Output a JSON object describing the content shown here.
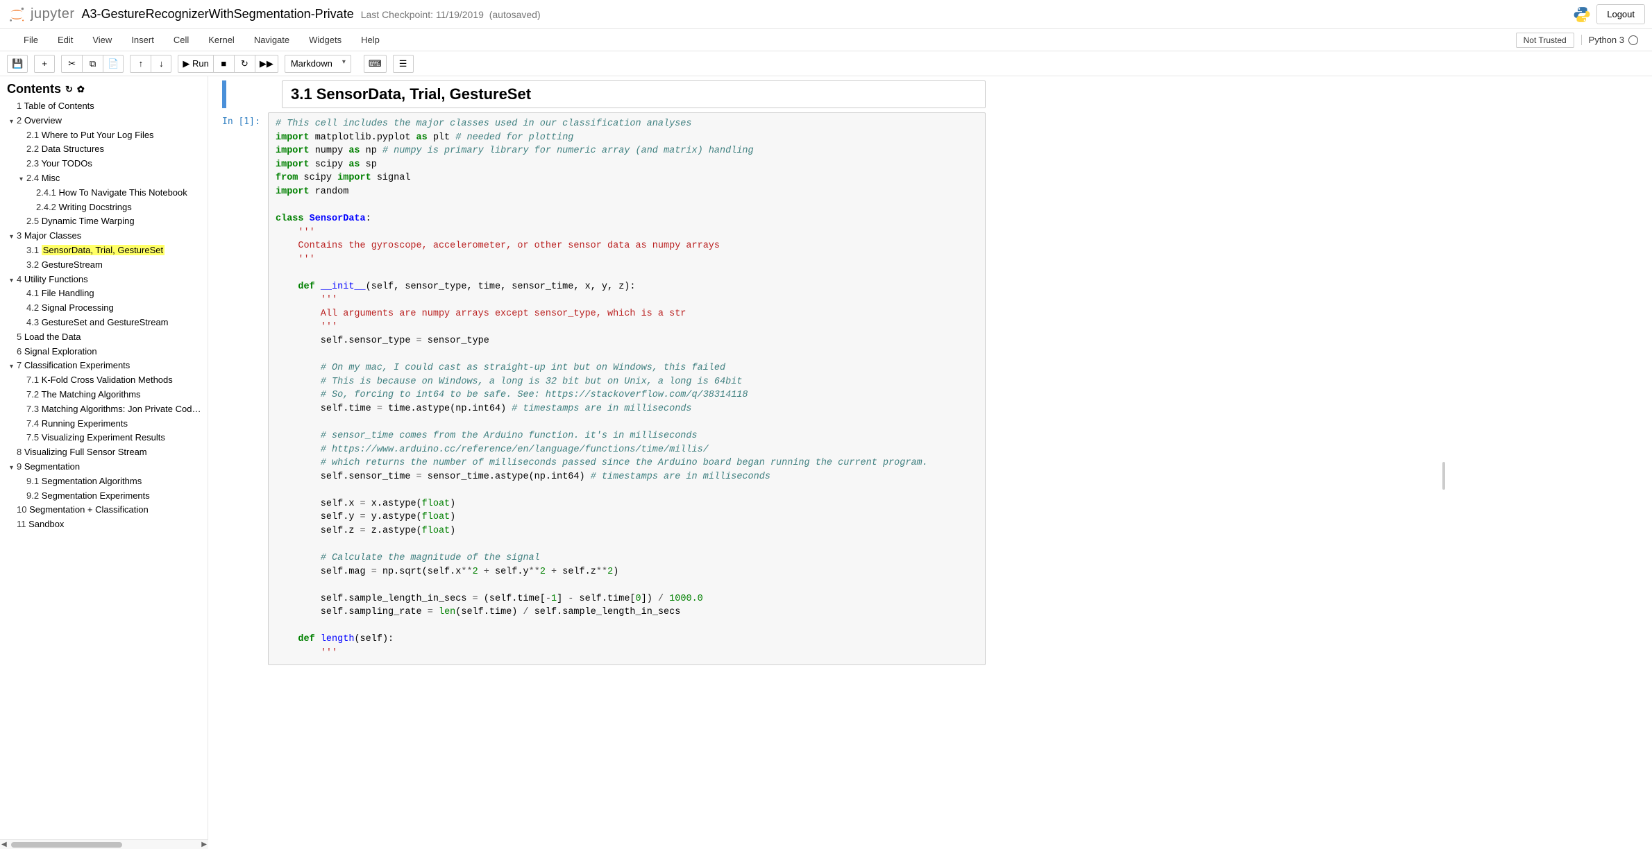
{
  "header": {
    "brand": "jupyter",
    "title": "A3-GestureRecognizerWithSegmentation-Private",
    "checkpoint": "Last Checkpoint: 11/19/2019",
    "autosave": "(autosaved)",
    "logout": "Logout"
  },
  "menu": {
    "items": [
      "File",
      "Edit",
      "View",
      "Insert",
      "Cell",
      "Kernel",
      "Navigate",
      "Widgets",
      "Help"
    ],
    "trust": "Not Trusted",
    "kernel": "Python 3"
  },
  "toolbar": {
    "save_icon": "💾",
    "add_icon": "+",
    "cut_icon": "✂",
    "copy_icon": "⧉",
    "paste_icon": "📄",
    "up_icon": "↑",
    "down_icon": "↓",
    "run_label": "▶ Run",
    "stop_icon": "■",
    "restart_icon": "↻",
    "restartall_icon": "▶▶",
    "cell_type": "Markdown",
    "keyboard_icon": "⌨",
    "list_icon": "☰"
  },
  "toc": {
    "title": "Contents",
    "items": [
      {
        "num": "1",
        "label": "Table of Contents",
        "indent": 0,
        "caret": ""
      },
      {
        "num": "2",
        "label": "Overview",
        "indent": 0,
        "caret": "▾"
      },
      {
        "num": "2.1",
        "label": "Where to Put Your Log Files",
        "indent": 1,
        "caret": ""
      },
      {
        "num": "2.2",
        "label": "Data Structures",
        "indent": 1,
        "caret": ""
      },
      {
        "num": "2.3",
        "label": "Your TODOs",
        "indent": 1,
        "caret": ""
      },
      {
        "num": "2.4",
        "label": "Misc",
        "indent": 1,
        "caret": "▾"
      },
      {
        "num": "2.4.1",
        "label": "How To Navigate This Notebook",
        "indent": 2,
        "caret": ""
      },
      {
        "num": "2.4.2",
        "label": "Writing Docstrings",
        "indent": 2,
        "caret": ""
      },
      {
        "num": "2.5",
        "label": "Dynamic Time Warping",
        "indent": 1,
        "caret": ""
      },
      {
        "num": "3",
        "label": "Major Classes",
        "indent": 0,
        "caret": "▾"
      },
      {
        "num": "3.1",
        "label": "SensorData, Trial, GestureSet",
        "indent": 1,
        "caret": "",
        "active": true
      },
      {
        "num": "3.2",
        "label": "GestureStream",
        "indent": 1,
        "caret": ""
      },
      {
        "num": "4",
        "label": "Utility Functions",
        "indent": 0,
        "caret": "▾"
      },
      {
        "num": "4.1",
        "label": "File Handling",
        "indent": 1,
        "caret": ""
      },
      {
        "num": "4.2",
        "label": "Signal Processing",
        "indent": 1,
        "caret": ""
      },
      {
        "num": "4.3",
        "label": "GestureSet and GestureStream",
        "indent": 1,
        "caret": ""
      },
      {
        "num": "5",
        "label": "Load the Data",
        "indent": 0,
        "caret": ""
      },
      {
        "num": "6",
        "label": "Signal Exploration",
        "indent": 0,
        "caret": ""
      },
      {
        "num": "7",
        "label": "Classification Experiments",
        "indent": 0,
        "caret": "▾"
      },
      {
        "num": "7.1",
        "label": "K-Fold Cross Validation Methods",
        "indent": 1,
        "caret": ""
      },
      {
        "num": "7.2",
        "label": "The Matching Algorithms",
        "indent": 1,
        "caret": ""
      },
      {
        "num": "7.3",
        "label": "Matching Algorithms: Jon Private Code (T",
        "indent": 1,
        "caret": ""
      },
      {
        "num": "7.4",
        "label": "Running Experiments",
        "indent": 1,
        "caret": ""
      },
      {
        "num": "7.5",
        "label": "Visualizing Experiment Results",
        "indent": 1,
        "caret": ""
      },
      {
        "num": "8",
        "label": "Visualizing Full Sensor Stream",
        "indent": 0,
        "caret": ""
      },
      {
        "num": "9",
        "label": "Segmentation",
        "indent": 0,
        "caret": "▾"
      },
      {
        "num": "9.1",
        "label": "Segmentation Algorithms",
        "indent": 1,
        "caret": ""
      },
      {
        "num": "9.2",
        "label": "Segmentation Experiments",
        "indent": 1,
        "caret": ""
      },
      {
        "num": "10",
        "label": "Segmentation + Classification",
        "indent": 0,
        "caret": ""
      },
      {
        "num": "11",
        "label": "Sandbox",
        "indent": 0,
        "caret": ""
      }
    ]
  },
  "cells": {
    "md_heading": "3.1  SensorData, Trial, GestureSet",
    "code_prompt": "In [1]:",
    "code_lines": [
      [
        {
          "t": "# This cell includes the major classes used in our classification analyses",
          "c": "c"
        }
      ],
      [
        {
          "t": "import",
          "c": "k"
        },
        {
          "t": " matplotlib.pyplot ",
          "c": "nn"
        },
        {
          "t": "as",
          "c": "k"
        },
        {
          "t": " plt ",
          "c": "nn"
        },
        {
          "t": "# needed for plotting",
          "c": "c"
        }
      ],
      [
        {
          "t": "import",
          "c": "k"
        },
        {
          "t": " numpy ",
          "c": "nn"
        },
        {
          "t": "as",
          "c": "k"
        },
        {
          "t": " np ",
          "c": "nn"
        },
        {
          "t": "# numpy is primary library for numeric array (and matrix) handling",
          "c": "c"
        }
      ],
      [
        {
          "t": "import",
          "c": "k"
        },
        {
          "t": " scipy ",
          "c": "nn"
        },
        {
          "t": "as",
          "c": "k"
        },
        {
          "t": " sp",
          "c": "nn"
        }
      ],
      [
        {
          "t": "from",
          "c": "k"
        },
        {
          "t": " scipy ",
          "c": "nn"
        },
        {
          "t": "import",
          "c": "k"
        },
        {
          "t": " signal",
          "c": "nn"
        }
      ],
      [
        {
          "t": "import",
          "c": "k"
        },
        {
          "t": " random",
          "c": "nn"
        }
      ],
      [],
      [
        {
          "t": "class",
          "c": "k"
        },
        {
          "t": " ",
          "c": "p"
        },
        {
          "t": "SensorData",
          "c": "nc"
        },
        {
          "t": ":",
          "c": "p"
        }
      ],
      [
        {
          "t": "    ",
          "c": "p"
        },
        {
          "t": "'''",
          "c": "s"
        }
      ],
      [
        {
          "t": "    Contains the gyroscope, accelerometer, or other sensor data as numpy arrays",
          "c": "s"
        }
      ],
      [
        {
          "t": "    ",
          "c": "p"
        },
        {
          "t": "'''",
          "c": "s"
        }
      ],
      [],
      [
        {
          "t": "    ",
          "c": "p"
        },
        {
          "t": "def",
          "c": "k"
        },
        {
          "t": " ",
          "c": "p"
        },
        {
          "t": "__init__",
          "c": "fm"
        },
        {
          "t": "(self, sensor_type, time, sensor_time, x, y, z):",
          "c": "p"
        }
      ],
      [
        {
          "t": "        ",
          "c": "p"
        },
        {
          "t": "'''",
          "c": "s"
        }
      ],
      [
        {
          "t": "        All arguments are numpy arrays except sensor_type, which is a str",
          "c": "s"
        }
      ],
      [
        {
          "t": "        ",
          "c": "p"
        },
        {
          "t": "'''",
          "c": "s"
        }
      ],
      [
        {
          "t": "        self.sensor_type ",
          "c": "p"
        },
        {
          "t": "=",
          "c": "o"
        },
        {
          "t": " sensor_type",
          "c": "p"
        }
      ],
      [],
      [
        {
          "t": "        ",
          "c": "p"
        },
        {
          "t": "# On my mac, I could cast as straight-up int but on Windows, this failed",
          "c": "c"
        }
      ],
      [
        {
          "t": "        ",
          "c": "p"
        },
        {
          "t": "# This is because on Windows, a long is 32 bit but on Unix, a long is 64bit",
          "c": "c"
        }
      ],
      [
        {
          "t": "        ",
          "c": "p"
        },
        {
          "t": "# So, forcing to int64 to be safe. See: https://stackoverflow.com/q/38314118",
          "c": "c"
        }
      ],
      [
        {
          "t": "        self.time ",
          "c": "p"
        },
        {
          "t": "=",
          "c": "o"
        },
        {
          "t": " time.astype(np.int64) ",
          "c": "p"
        },
        {
          "t": "# timestamps are in milliseconds",
          "c": "c"
        }
      ],
      [],
      [
        {
          "t": "        ",
          "c": "p"
        },
        {
          "t": "# sensor_time comes from the Arduino function. it's in milliseconds",
          "c": "c"
        }
      ],
      [
        {
          "t": "        ",
          "c": "p"
        },
        {
          "t": "# https://www.arduino.cc/reference/en/language/functions/time/millis/",
          "c": "c"
        }
      ],
      [
        {
          "t": "        ",
          "c": "p"
        },
        {
          "t": "# which returns the number of milliseconds passed since the Arduino board began running the current program.",
          "c": "c"
        }
      ],
      [
        {
          "t": "        self.sensor_time ",
          "c": "p"
        },
        {
          "t": "=",
          "c": "o"
        },
        {
          "t": " sensor_time.astype(np.int64) ",
          "c": "p"
        },
        {
          "t": "# timestamps are in milliseconds",
          "c": "c"
        }
      ],
      [],
      [
        {
          "t": "        self.x ",
          "c": "p"
        },
        {
          "t": "=",
          "c": "o"
        },
        {
          "t": " x.astype(",
          "c": "p"
        },
        {
          "t": "float",
          "c": "bn"
        },
        {
          "t": ")",
          "c": "p"
        }
      ],
      [
        {
          "t": "        self.y ",
          "c": "p"
        },
        {
          "t": "=",
          "c": "o"
        },
        {
          "t": " y.astype(",
          "c": "p"
        },
        {
          "t": "float",
          "c": "bn"
        },
        {
          "t": ")",
          "c": "p"
        }
      ],
      [
        {
          "t": "        self.z ",
          "c": "p"
        },
        {
          "t": "=",
          "c": "o"
        },
        {
          "t": " z.astype(",
          "c": "p"
        },
        {
          "t": "float",
          "c": "bn"
        },
        {
          "t": ")",
          "c": "p"
        }
      ],
      [],
      [
        {
          "t": "        ",
          "c": "p"
        },
        {
          "t": "# Calculate the magnitude of the signal",
          "c": "c"
        }
      ],
      [
        {
          "t": "        self.mag ",
          "c": "p"
        },
        {
          "t": "=",
          "c": "o"
        },
        {
          "t": " np.sqrt(self.x",
          "c": "p"
        },
        {
          "t": "**",
          "c": "o"
        },
        {
          "t": "2",
          "c": "mi"
        },
        {
          "t": " ",
          "c": "p"
        },
        {
          "t": "+",
          "c": "o"
        },
        {
          "t": " self.y",
          "c": "p"
        },
        {
          "t": "**",
          "c": "o"
        },
        {
          "t": "2",
          "c": "mi"
        },
        {
          "t": " ",
          "c": "p"
        },
        {
          "t": "+",
          "c": "o"
        },
        {
          "t": " self.z",
          "c": "p"
        },
        {
          "t": "**",
          "c": "o"
        },
        {
          "t": "2",
          "c": "mi"
        },
        {
          "t": ")",
          "c": "p"
        }
      ],
      [],
      [
        {
          "t": "        self.sample_length_in_secs ",
          "c": "p"
        },
        {
          "t": "=",
          "c": "o"
        },
        {
          "t": " (self.time[",
          "c": "p"
        },
        {
          "t": "-",
          "c": "o"
        },
        {
          "t": "1",
          "c": "mi"
        },
        {
          "t": "] ",
          "c": "p"
        },
        {
          "t": "-",
          "c": "o"
        },
        {
          "t": " self.time[",
          "c": "p"
        },
        {
          "t": "0",
          "c": "mi"
        },
        {
          "t": "]) ",
          "c": "p"
        },
        {
          "t": "/",
          "c": "o"
        },
        {
          "t": " ",
          "c": "p"
        },
        {
          "t": "1000.0",
          "c": "mf"
        }
      ],
      [
        {
          "t": "        self.sampling_rate ",
          "c": "p"
        },
        {
          "t": "=",
          "c": "o"
        },
        {
          "t": " ",
          "c": "p"
        },
        {
          "t": "len",
          "c": "bn"
        },
        {
          "t": "(self.time) ",
          "c": "p"
        },
        {
          "t": "/",
          "c": "o"
        },
        {
          "t": " self.sample_length_in_secs",
          "c": "p"
        }
      ],
      [],
      [
        {
          "t": "    ",
          "c": "p"
        },
        {
          "t": "def",
          "c": "k"
        },
        {
          "t": " ",
          "c": "p"
        },
        {
          "t": "length",
          "c": "nf"
        },
        {
          "t": "(self):",
          "c": "p"
        }
      ],
      [
        {
          "t": "        ",
          "c": "p"
        },
        {
          "t": "'''",
          "c": "s"
        }
      ]
    ]
  }
}
